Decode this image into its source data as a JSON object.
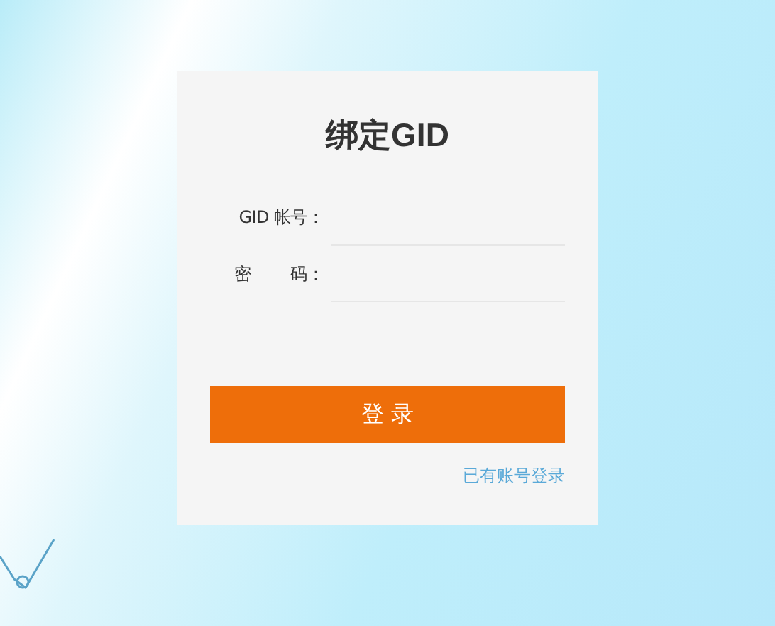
{
  "title": "绑定GID",
  "fields": [
    {
      "label": "GID 帐号："
    },
    {
      "label": "密        码："
    }
  ],
  "submit_button": "登 录",
  "login_link": "已有账号登录"
}
